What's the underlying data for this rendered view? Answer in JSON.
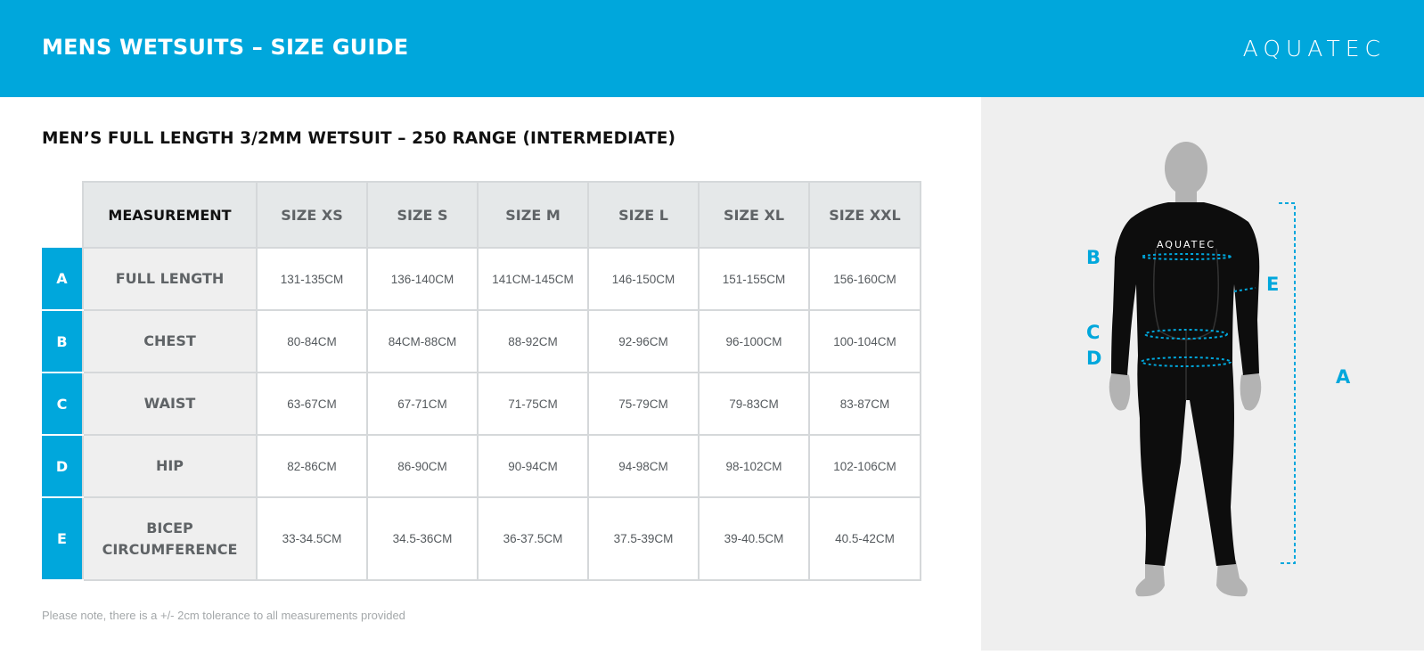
{
  "header": {
    "title": "MENS WETSUITS – SIZE GUIDE",
    "brand": "AQUATEC"
  },
  "section_title": "MEN’S FULL LENGTH 3/2MM WETSUIT – 250 RANGE (INTERMEDIATE)",
  "table": {
    "columns": [
      "MEASUREMENT",
      "SIZE XS",
      "SIZE S",
      "SIZE M",
      "SIZE L",
      "SIZE XL",
      "SIZE XXL"
    ],
    "rows": [
      {
        "letter": "A",
        "name": "FULL LENGTH",
        "values": [
          "131-135CM",
          "136-140CM",
          "141CM-145CM",
          "146-150CM",
          "151-155CM",
          "156-160CM"
        ]
      },
      {
        "letter": "B",
        "name": "CHEST",
        "values": [
          "80-84CM",
          "84CM-88CM",
          "88-92CM",
          "92-96CM",
          "96-100CM",
          "100-104CM"
        ]
      },
      {
        "letter": "C",
        "name": "WAIST",
        "values": [
          "63-67CM",
          "67-71CM",
          "71-75CM",
          "75-79CM",
          "79-83CM",
          "83-87CM"
        ]
      },
      {
        "letter": "D",
        "name": "HIP",
        "values": [
          "82-86CM",
          "86-90CM",
          "90-94CM",
          "94-98CM",
          "98-102CM",
          "102-106CM"
        ]
      },
      {
        "letter": "E",
        "name_lines": [
          "BICEP",
          "CIRCUMFERENCE"
        ],
        "values": [
          "33-34.5CM",
          "34.5-36CM",
          "36-37.5CM",
          "37.5-39CM",
          "39-40.5CM",
          "40.5-42CM"
        ]
      }
    ]
  },
  "footnote": "Please note, there is a +/- 2cm tolerance to all measurements provided",
  "figure": {
    "suit_brand": "AQUATEC",
    "labels": {
      "A": "A",
      "B": "B",
      "C": "C",
      "D": "D",
      "E": "E"
    },
    "accent_color": "#00a7dc",
    "suit_color": "#0d0d0d",
    "skin_color": "#b3b3b3"
  },
  "colors": {
    "header_bg": "#00a7dc",
    "panel_bg": "#efefef",
    "table_head_bg": "#e5e8e9",
    "label_col_bg": "#efefef"
  }
}
